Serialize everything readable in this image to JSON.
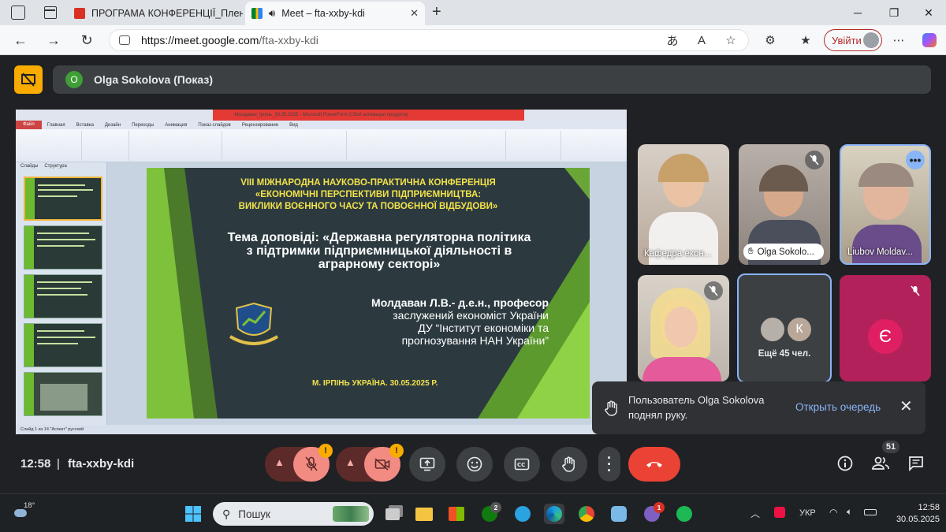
{
  "browser": {
    "tabs": [
      {
        "label": "ПРОГРАМА КОНФЕРЕНЦІЇ_Плен",
        "icon": "pdf-icon",
        "active": false
      },
      {
        "label": "Meet – fta-xxby-kdi",
        "icon": "meet-icon",
        "active": true
      }
    ],
    "url_host": "https://meet.google.com",
    "url_path": "/fta-xxby-kdi",
    "signin_label": "Увійти"
  },
  "meet": {
    "presenter_initial": "O",
    "presenter_label": "Olga Sokolova (Показ)",
    "participants": [
      {
        "name": "Кафедра екон...",
        "muted": false
      },
      {
        "name": "Olga Sokolo...",
        "muted": true,
        "hand": true
      },
      {
        "name": "Liubov Moldav...",
        "muted": false,
        "more": true
      },
      {
        "name": "",
        "muted": true
      }
    ],
    "others_tile": {
      "initial": "К",
      "label": "Ещё 45 чел."
    },
    "avatar_tile": {
      "initial": "Є"
    },
    "toast": {
      "message": "Пользователь Olga Sokolova поднял руку.",
      "action": "Открыть очередь"
    },
    "clock": "12:58",
    "separator": "|",
    "meeting_code": "fta-xxby-kdi",
    "participant_count": "51",
    "accent_end_call": "#ea4335",
    "accent_muted": "#f28b82"
  },
  "slide": {
    "conf_lines": [
      "VIII МІЖНАРОДНА НАУКОВО-ПРАКТИЧНА КОНФЕРЕНЦІЯ",
      "«ЕКОНОМІЧНІ ПЕРСПЕКТИВИ ПІДПРИЄМНИЦТВА:",
      "ВИКЛИКИ ВОЄННОГО ЧАСУ ТА ПОВОЄННОЇ ВІДБУДОВИ»"
    ],
    "topic_lines": [
      "Тема доповіді: «Державна регуляторна політика",
      "з підтримки підприємницької діяльності в",
      "аграрному секторі»"
    ],
    "author_lines": [
      "Молдаван Л.В.- д.е.н., професор",
      "заслужений економіст України",
      "ДУ “Інститут економіки та",
      "прогнозування НАН України”"
    ],
    "footer": "М. ІРПІНЬ УКРАЇНА. 30.05.2025 Р."
  },
  "ppt": {
    "title": "Молдаван_Ірпінь_30.05.2025 - Microsoft PowerPoint (Сбой активации продукта)",
    "tabs": [
      "Файл",
      "Главная",
      "Вставка",
      "Дизайн",
      "Переходы",
      "Анимация",
      "Показ слайдов",
      "Рецензирование",
      "Вид"
    ],
    "panel_tabs": [
      "Слайды",
      "Структура"
    ],
    "status": "Слайд 1 из 14   \"Аспект\"   русский"
  },
  "taskbar": {
    "temperature": "18°",
    "search_placeholder": "Пошук",
    "lang": "УКР",
    "time": "12:58",
    "date": "30.05.2025",
    "badges": {
      "xbox": "2",
      "viber": "1"
    }
  }
}
